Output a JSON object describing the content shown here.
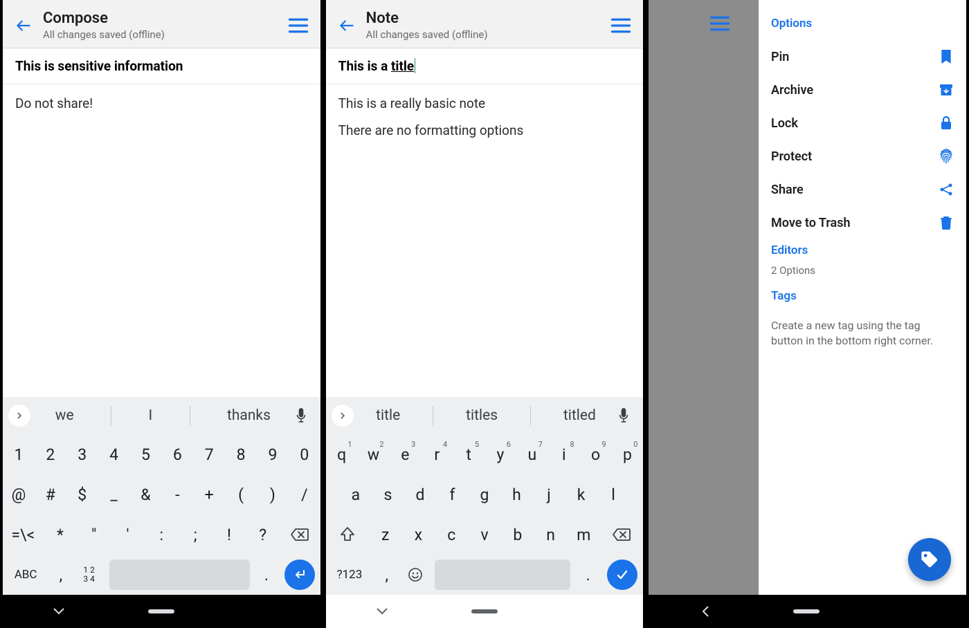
{
  "screen1": {
    "title": "Compose",
    "subtitle": "All changes saved (offline)",
    "note_title": "This is sensitive information",
    "body": "Do not share!",
    "suggestions": [
      "we",
      "I",
      "thanks"
    ],
    "row1": [
      "1",
      "2",
      "3",
      "4",
      "5",
      "6",
      "7",
      "8",
      "9",
      "0"
    ],
    "row2": [
      "@",
      "#",
      "$",
      "_",
      "&",
      "-",
      "+",
      "(",
      ")",
      "/"
    ],
    "row3": [
      "=\\<",
      "*",
      "\"",
      "'",
      ":",
      ";",
      "!",
      "?"
    ],
    "abc": "ABC",
    "numpad_top": "1 2",
    "numpad_bottom": "3 4"
  },
  "screen2": {
    "title": "Note",
    "subtitle": "All changes saved (offline)",
    "note_title_prefix": "This is a ",
    "note_title_underlined": "title",
    "body_line1": "This is a really basic note",
    "body_line2": "There are no formatting options",
    "suggestions": [
      "title",
      "titles",
      "titled"
    ],
    "row1": [
      {
        "k": "q",
        "s": "1"
      },
      {
        "k": "w",
        "s": "2"
      },
      {
        "k": "e",
        "s": "3"
      },
      {
        "k": "r",
        "s": "4"
      },
      {
        "k": "t",
        "s": "5"
      },
      {
        "k": "y",
        "s": "6"
      },
      {
        "k": "u",
        "s": "7"
      },
      {
        "k": "i",
        "s": "8"
      },
      {
        "k": "o",
        "s": "9"
      },
      {
        "k": "p",
        "s": "0"
      }
    ],
    "row2": [
      "a",
      "s",
      "d",
      "f",
      "g",
      "h",
      "j",
      "k",
      "l"
    ],
    "row3": [
      "z",
      "x",
      "c",
      "v",
      "b",
      "n",
      "m"
    ],
    "sym": "?123"
  },
  "screen3": {
    "sections": {
      "options_label": "Options",
      "editors_label": "Editors",
      "editors_sub": "2 Options",
      "tags_label": "Tags",
      "tags_help": "Create a new tag using the tag button in the bottom right corner."
    },
    "options": [
      {
        "label": "Pin",
        "icon": "bookmark"
      },
      {
        "label": "Archive",
        "icon": "archive"
      },
      {
        "label": "Lock",
        "icon": "lock"
      },
      {
        "label": "Protect",
        "icon": "fingerprint"
      },
      {
        "label": "Share",
        "icon": "share"
      },
      {
        "label": "Move to Trash",
        "icon": "trash"
      }
    ]
  },
  "colors": {
    "accent": "#1a73e8"
  }
}
